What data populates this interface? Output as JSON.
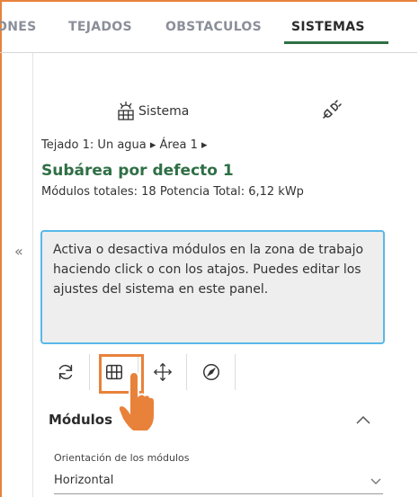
{
  "tabs": [
    {
      "label": "ONES",
      "active": false
    },
    {
      "label": "TEJADOS",
      "active": false
    },
    {
      "label": "OBSTACULOS",
      "active": false
    },
    {
      "label": "SISTEMAS",
      "active": true
    }
  ],
  "system": {
    "label": "Sistema"
  },
  "breadcrumb": "Tejado 1: Un agua ▸ Área 1 ▸",
  "subarea": {
    "title": "Subárea por defecto 1",
    "totals": "Módulos totales: 18 Potencia Total: 6,12 kWp"
  },
  "collapse_glyph": "«",
  "info_text": "Activa o desactiva módulos en la zona de trabajo haciendo click o con los atajos. Puedes editar los ajustes del sistema en este panel.",
  "toolbar": {
    "tools": [
      "refresh-icon",
      "grid-icon",
      "move-icon",
      "compass-icon"
    ],
    "highlighted": "grid-icon"
  },
  "modules": {
    "heading": "Módulos",
    "orientation_label": "Orientación de los módulos",
    "orientation_value": "Horizontal"
  },
  "colors": {
    "accent": "#2f6f45",
    "highlight": "#e8823a",
    "info_border": "#59b8ea"
  }
}
